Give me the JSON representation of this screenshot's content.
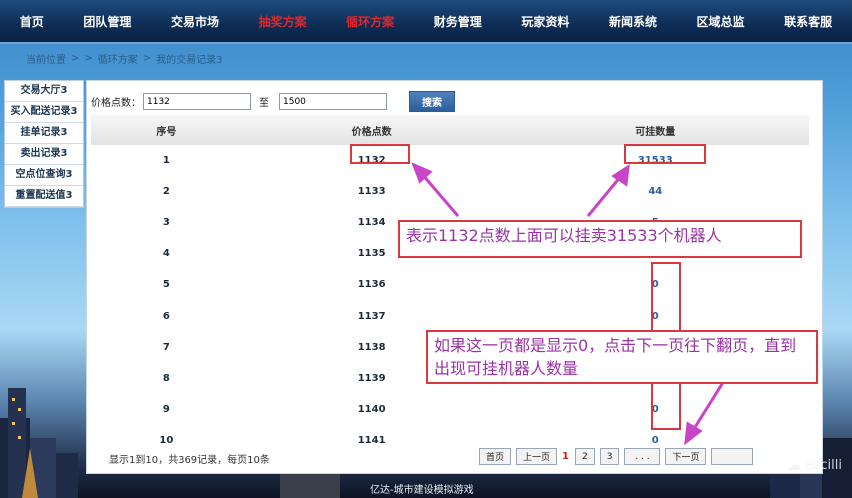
{
  "nav": {
    "items": [
      {
        "label": "首页",
        "active": false
      },
      {
        "label": "团队管理",
        "active": false
      },
      {
        "label": "交易市场",
        "active": false
      },
      {
        "label": "抽奖方案",
        "active": true
      },
      {
        "label": "循环方案",
        "active": true
      },
      {
        "label": "财务管理",
        "active": false
      },
      {
        "label": "玩家资料",
        "active": false
      },
      {
        "label": "新闻系统",
        "active": false
      },
      {
        "label": "区域总监",
        "active": false
      },
      {
        "label": "联系客服",
        "active": false
      }
    ]
  },
  "breadcrumb": {
    "current_label": "当前位置",
    "sep1": ">",
    "sep2": ">",
    "section": "循环方案",
    "sep3": ">",
    "page": "我的交易记录3"
  },
  "sidebar": {
    "items": [
      {
        "label": "交易大厅3"
      },
      {
        "label": "买入配送记录3"
      },
      {
        "label": "挂单记录3"
      },
      {
        "label": "卖出记录3"
      },
      {
        "label": "空点位查询3"
      },
      {
        "label": "重置配送值3"
      }
    ]
  },
  "filter": {
    "label": "价格点数：",
    "from_value": "1132",
    "to_label": "至",
    "to_value": "1500",
    "search_label": "搜索"
  },
  "table": {
    "headers": [
      "序号",
      "价格点数",
      "可挂数量"
    ],
    "rows": [
      [
        "1",
        "1132",
        "31533"
      ],
      [
        "2",
        "1133",
        "44"
      ],
      [
        "3",
        "1134",
        "5"
      ],
      [
        "4",
        "1135",
        ""
      ],
      [
        "5",
        "1136",
        "0"
      ],
      [
        "6",
        "1137",
        "0"
      ],
      [
        "7",
        "1138",
        "0"
      ],
      [
        "8",
        "1139",
        "0"
      ],
      [
        "9",
        "1140",
        "0"
      ],
      [
        "10",
        "1141",
        "0"
      ]
    ]
  },
  "footer": {
    "info": "显示1到10，共369记录，每页10条"
  },
  "pager": {
    "first": "首页",
    "prev": "上一页",
    "current": "1",
    "pages": [
      "2",
      "3"
    ],
    "ellipsis": ". . .",
    "next": "下一页"
  },
  "annotations": {
    "note1": "表示1132点数上面可以挂卖31533个机器人",
    "note2": "如果这一页都是显示0，点击下一页往下翻页，直到出现可挂机器人数量",
    "color": "#d8393f",
    "text_color": "#9b33a6",
    "arrow_color": "#c844c8"
  },
  "watermark": "ezcilli",
  "bottom_caption": "亿达-城市建设模拟游戏",
  "colors": {
    "nav_bg": "#0e2c55",
    "nav_active": "#e3262b",
    "sidebar_text": "#1c3553",
    "search_button": "#2b5e9b"
  }
}
